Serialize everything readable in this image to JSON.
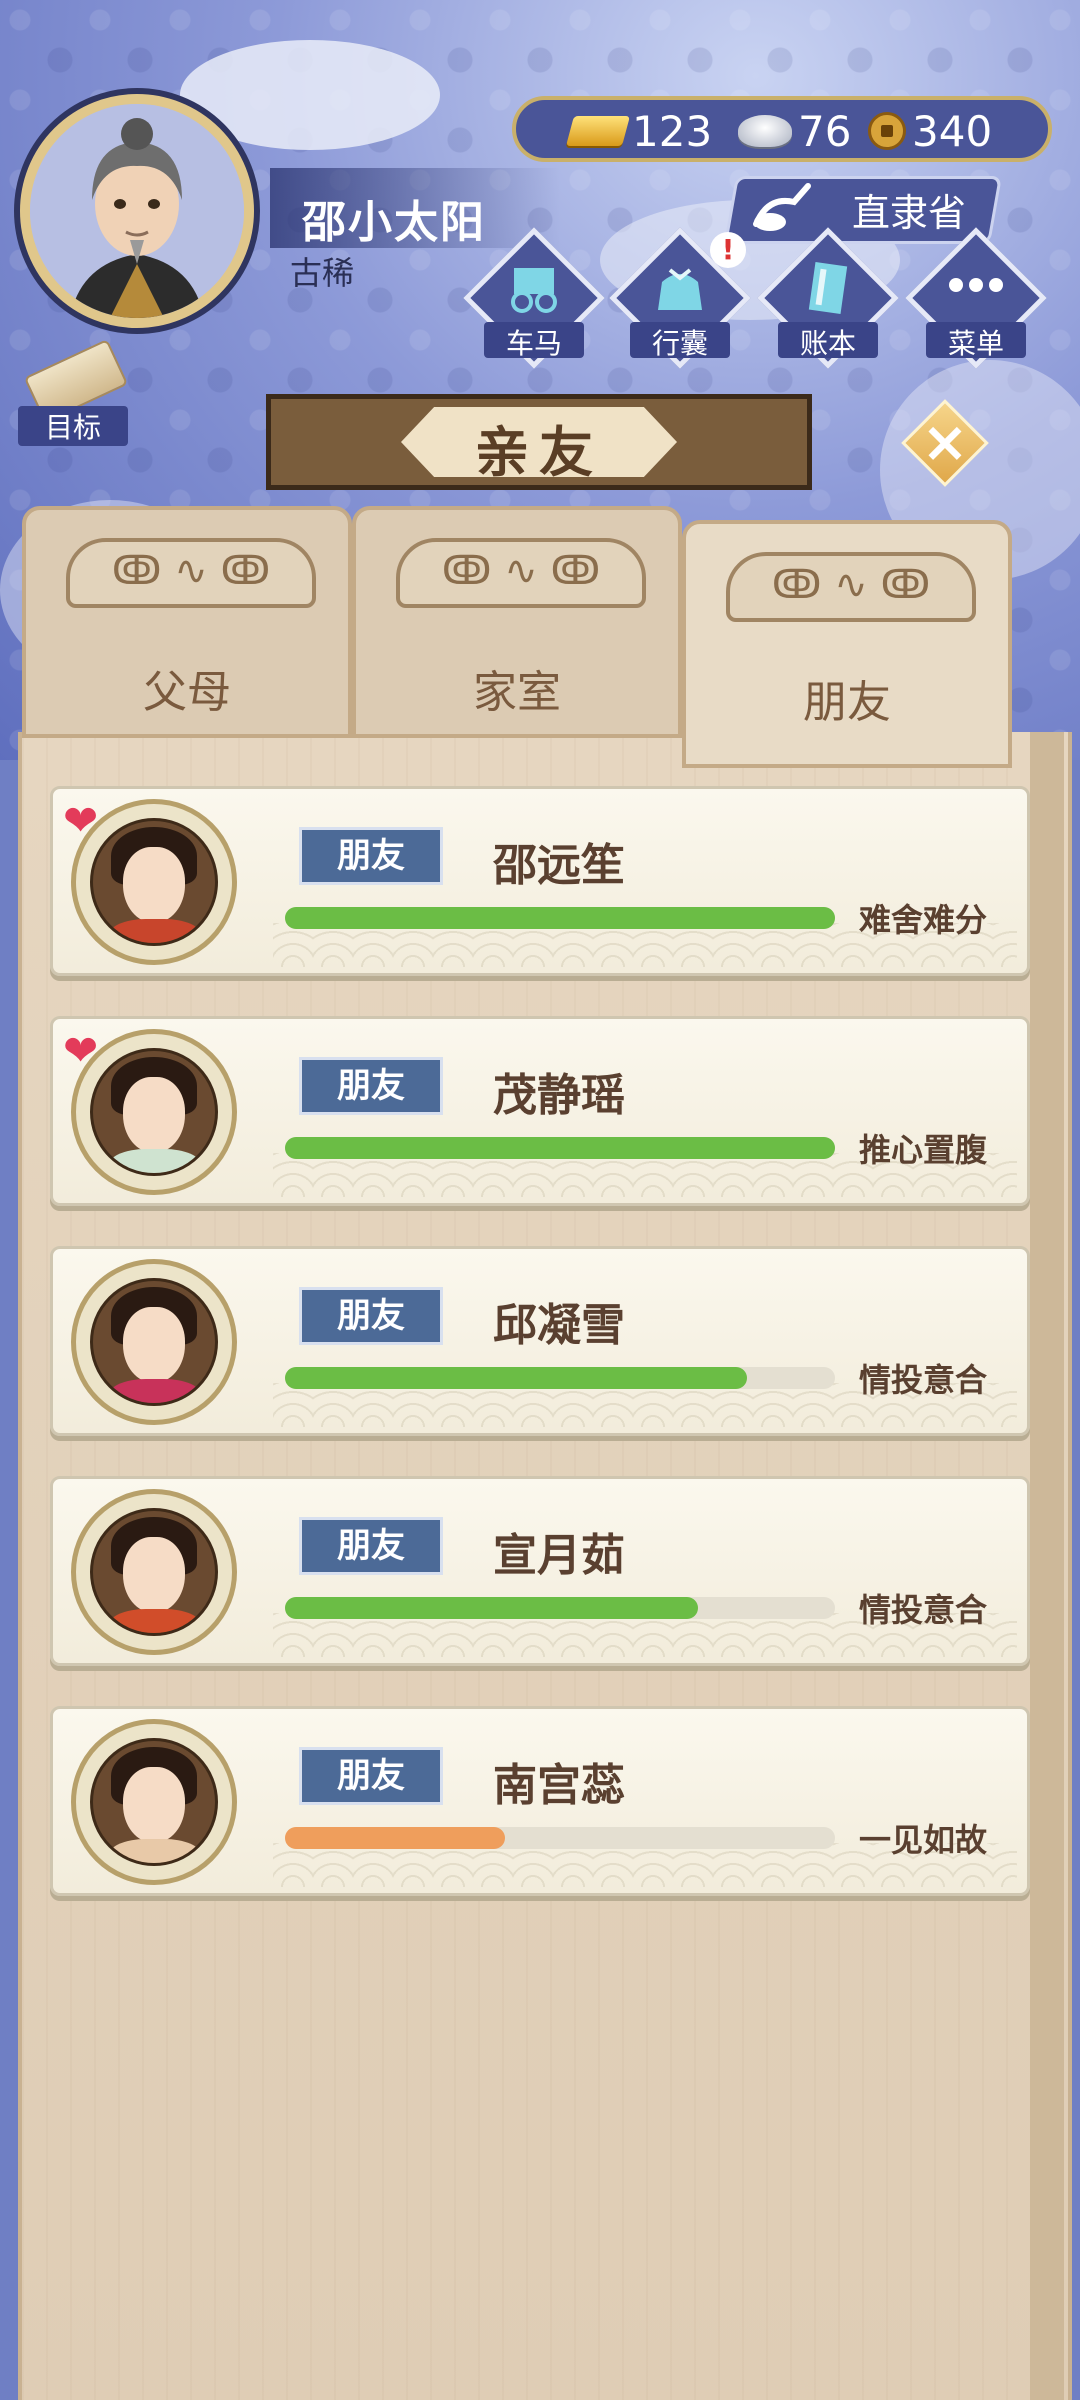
{
  "player": {
    "name": "邵小太阳",
    "age_title": "古稀",
    "province": "直隶省"
  },
  "currency": {
    "gold": "123",
    "silver": "76",
    "coins": "340"
  },
  "menu": {
    "carriage": "车马",
    "bag": "行囊",
    "ledger": "账本",
    "menu": "菜单",
    "bag_alert": "!"
  },
  "goal_label": "目标",
  "panel": {
    "title": "亲友",
    "close_icon": "×"
  },
  "tabs": [
    {
      "label": "父母",
      "active": false
    },
    {
      "label": "家室",
      "active": false
    },
    {
      "label": "朋友",
      "active": true
    }
  ],
  "friends": [
    {
      "relation": "朋友",
      "name": "邵远笙",
      "status": "难舍难分",
      "affinity": 1.0,
      "bar_color": "#6bbd45",
      "heart": true
    },
    {
      "relation": "朋友",
      "name": "茂静瑶",
      "status": "推心置腹",
      "affinity": 1.0,
      "bar_color": "#6bbd45",
      "heart": true
    },
    {
      "relation": "朋友",
      "name": "邱凝雪",
      "status": "情投意合",
      "affinity": 0.84,
      "bar_color": "#6bbd45",
      "heart": false
    },
    {
      "relation": "朋友",
      "name": "宣月茹",
      "status": "情投意合",
      "affinity": 0.75,
      "bar_color": "#6bbd45",
      "heart": false
    },
    {
      "relation": "朋友",
      "name": "南宫蕊",
      "status": "一见如故",
      "affinity": 0.4,
      "bar_color": "#ef9e5c",
      "heart": false
    }
  ],
  "icons": {
    "heart": "heart-icon",
    "gold": "gold-ingot-icon",
    "silver": "silver-ingot-icon",
    "coin": "copper-coin-icon"
  }
}
